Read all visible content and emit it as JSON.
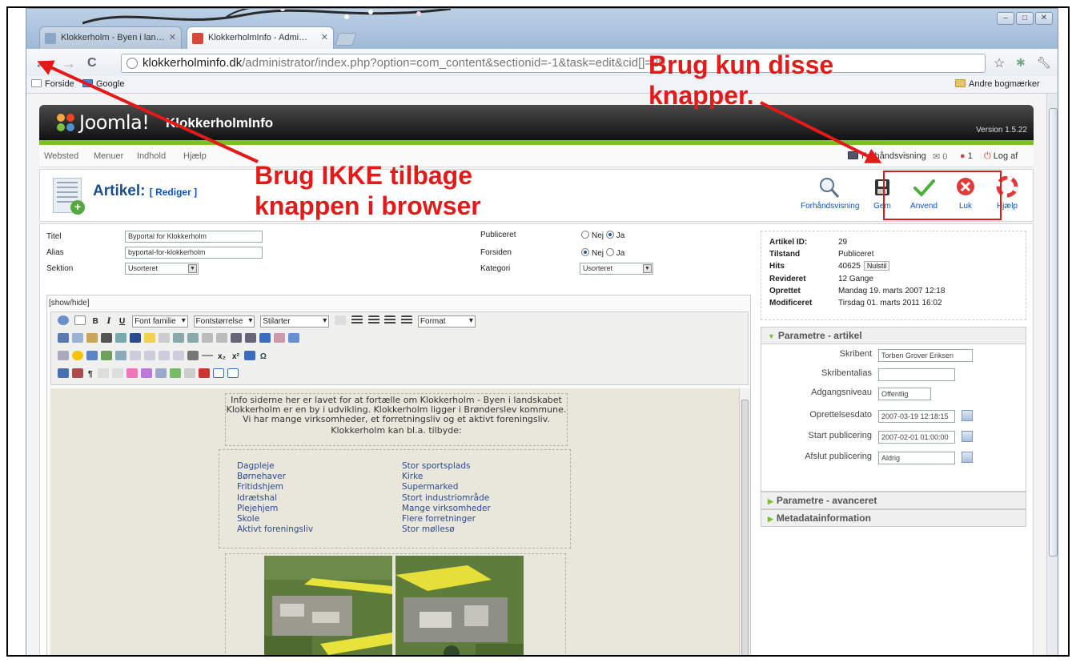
{
  "browser": {
    "tabs": [
      {
        "label": "Klokkerholm - Byen i lan…"
      },
      {
        "label": "KlokkerholmInfo - Admi…"
      }
    ],
    "url_domain": "klokkerholminfo.dk",
    "url_path": "/administrator/index.php?option=com_content&sectionid=-1&task=edit&cid[]=29",
    "bookmarks": [
      "Forside",
      "Google"
    ],
    "other_bookmarks": "Andre bogmærker"
  },
  "joomla": {
    "logo_text": "Joomla!",
    "site_name": "KlokkerholmInfo",
    "version": "Version 1.5.22",
    "menu": [
      "Websted",
      "Menuer",
      "Indhold",
      "Hjælp"
    ],
    "status": {
      "preview": "Forhåndsvisning",
      "messages": "0",
      "users": "1",
      "logout": "Log af"
    }
  },
  "toolbar": {
    "title": "Artikel:",
    "subtitle": "[ Rediger ]",
    "buttons": [
      "Forhåndsvisning",
      "Gem",
      "Anvend",
      "Luk",
      "Hjælp"
    ]
  },
  "form": {
    "title_label": "Titel",
    "title_value": "Byportal for Klokkerholm",
    "alias_label": "Alias",
    "alias_value": "byportal-for-klokkerholm",
    "section_label": "Sektion",
    "section_value": "Usorteret",
    "published_label": "Publiceret",
    "frontpage_label": "Forsiden",
    "category_label": "Kategori",
    "category_value": "Usorteret",
    "no": "Nej",
    "yes": "Ja"
  },
  "editor": {
    "showhide": "[show/hide]",
    "font_family": "Font familie",
    "font_size": "Fontstørrelse",
    "styles": "Stilarter",
    "format": "Format",
    "intro_lines": [
      "Info siderne her er lavet for at fortælle om Klokkerholm - Byen i landskabet",
      "Klokkerholm er en by i udvikling. Klokkerholm ligger i Brønderslev kommune.",
      "Vi har mange  virksomheder, et forretningsliv og et aktivt foreningsliv.",
      "Klokkerholm kan bl.a. tilbyde:"
    ],
    "list_left": [
      "Dagpleje",
      "Børnehaver",
      "Fritidshjem",
      "Idrætshal",
      "Plejehjem",
      "Skole",
      "Aktivt foreningsliv"
    ],
    "list_right": [
      "Stor sportsplads",
      "Kirke",
      "Supermarked",
      "Stort industriområde",
      "Mange virksomheder",
      "Flere forretninger",
      "Stor møllesø"
    ]
  },
  "info": {
    "id_label": "Artikel ID:",
    "id": "29",
    "state_label": "Tilstand",
    "state": "Publiceret",
    "hits_label": "Hits",
    "hits": "40625",
    "reset": "Nulstil",
    "revised_label": "Revideret",
    "revised": "12 Gange",
    "created_label": "Oprettet",
    "created": "Mandag 19. marts 2007 12:18",
    "modified_label": "Modificeret",
    "modified": "Tirsdag 01. marts 2011 16:02"
  },
  "params": {
    "header": "Parametre - artikel",
    "author_label": "Skribent",
    "author": "Torben Grover Eriksen",
    "alias_label": "Skribentalias",
    "access_label": "Adgangsniveau",
    "access": "Offentlig",
    "created_label": "Oprettelsesdato",
    "created": "2007-03-19 12:18:15",
    "start_label": "Start publicering",
    "start": "2007-02-01 01:00:00",
    "end_label": "Afslut publicering",
    "end": "Aldrig",
    "advanced": "Parametre - avanceret",
    "metadata": "Metadatainformation"
  },
  "annotations": {
    "use_only": [
      "Brug kun disse",
      "knapper."
    ],
    "no_back": [
      "Brug IKKE tilbage",
      "knappen i browser"
    ]
  },
  "colors": {
    "accent_red": "#e21a1a",
    "joomla_green": "#7cbf2e",
    "link_blue": "#0b55c4"
  }
}
